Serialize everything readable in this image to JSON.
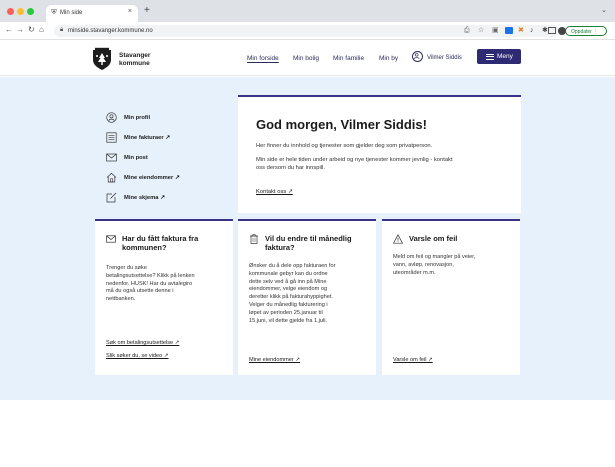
{
  "browser": {
    "tab_title": "Min side",
    "tab_close": "×",
    "new_tab": "+",
    "url": "minside.stavanger.kommune.no",
    "update_label": "Oppdater"
  },
  "header": {
    "brand_line1": "Stavanger",
    "brand_line2": "kommune",
    "nav": [
      "Min forside",
      "Min bolig",
      "Min familie",
      "Min by"
    ],
    "user_name": "Vilmer Siddis",
    "menu_label": "Meny"
  },
  "profile_menu": {
    "items": [
      {
        "label": "Min profil",
        "icon": "user-circle-icon"
      },
      {
        "label": "Mine fakturaer ↗",
        "icon": "invoice-icon"
      },
      {
        "label": "Min post",
        "icon": "mail-icon"
      },
      {
        "label": "Mine eiendommer ↗",
        "icon": "home-icon"
      },
      {
        "label": "Mine skjema ↗",
        "icon": "edit-form-icon"
      }
    ]
  },
  "greeting": {
    "title": "God morgen, Vilmer Siddis!",
    "p1": "Her finner du innhold og tjenester som gjelder deg som privatperson.",
    "p2_line1": "Min side er hele tiden under arbeid og nye tjenester kommer jevnlig - kontakt",
    "p2_line2": "oss dersom du har innspill.",
    "link": "Kontakt oss ↗"
  },
  "cards": [
    {
      "icon": "mail-icon",
      "title_lines": [
        "Har du fått faktura fra",
        "kommunen?"
      ],
      "body_lines": [
        "Trenger du søke",
        "betalingsutsettelse? Klikk på lenken",
        "nedenfor. HUSK! Har du avtalegiro",
        "må du også utsette denne i",
        "nettbanken."
      ],
      "links": [
        "Søk om betalingsutsettelse ↗",
        "Slik søker du, se video ↗"
      ]
    },
    {
      "icon": "trash-icon",
      "title_lines": [
        "Vil du endre til månedlig",
        "faktura?"
      ],
      "body_lines": [
        "Ønsker du å dele opp fakturaen for",
        "kommunale gebyr kan du ordne",
        "dette selv ved å gå inn på Mine",
        "eiendommer, velge eiendom og",
        "deretter klikk på fakturahyppighet.",
        "Velger du månedlig fakturering i",
        "løpet av perioden 25.januar til",
        "15.juni, vil dette gjelde fra 1.juli."
      ],
      "links": [
        "Mine eiendommer ↗"
      ]
    },
    {
      "icon": "warning-icon",
      "title_lines": [
        "Varsle om feil"
      ],
      "body_lines": [
        "Meld om feil og mangler på veier,",
        "vann, avløp, renovasjon,",
        "uteområder m.m."
      ],
      "links": [
        "Varsle om feil ↗"
      ]
    }
  ],
  "colors": {
    "accent": "#2e2a73",
    "content_bg": "#e7f1fb",
    "update_green": "#1a7f37"
  }
}
